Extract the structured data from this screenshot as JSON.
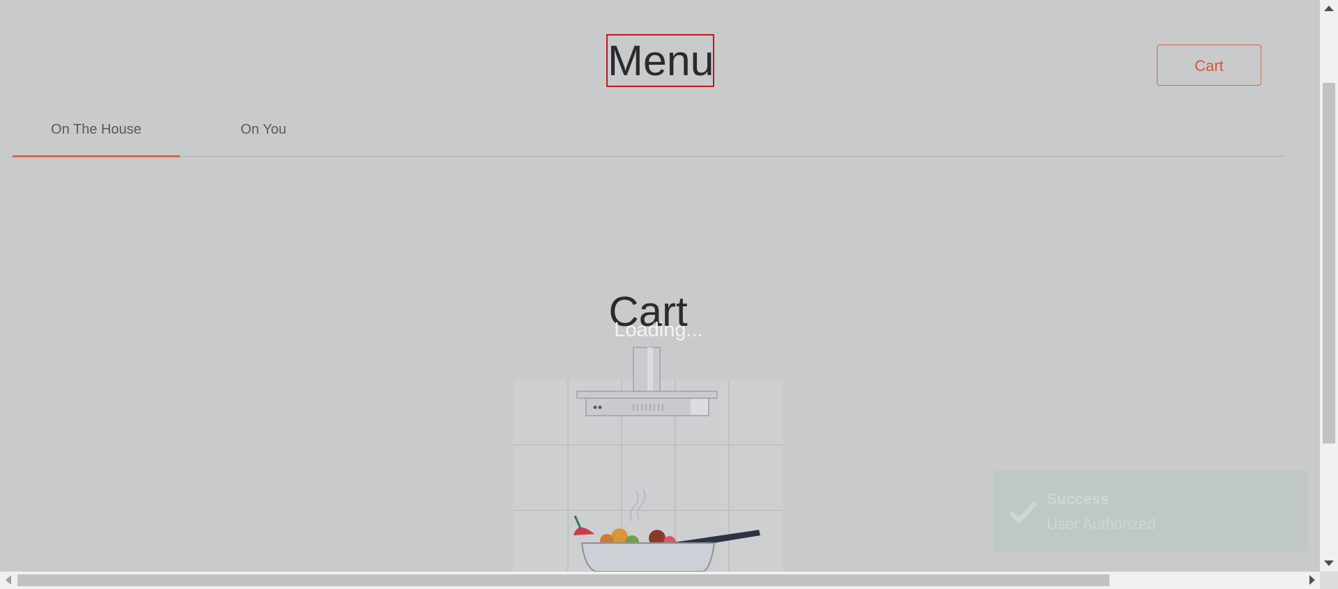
{
  "header": {
    "title": "Menu",
    "cart_button": "Cart"
  },
  "tabs": [
    {
      "label": "On The House",
      "active": true
    },
    {
      "label": "On You",
      "active": false
    }
  ],
  "main": {
    "heading": "Cart",
    "loading_text": "Loading..."
  },
  "toast": {
    "title": "Success",
    "message": "User Authorized",
    "icon": "check-icon"
  },
  "colors": {
    "accent": "#d3683f",
    "highlight_border": "#c0171e",
    "background_overlay": "#c9cacc"
  }
}
